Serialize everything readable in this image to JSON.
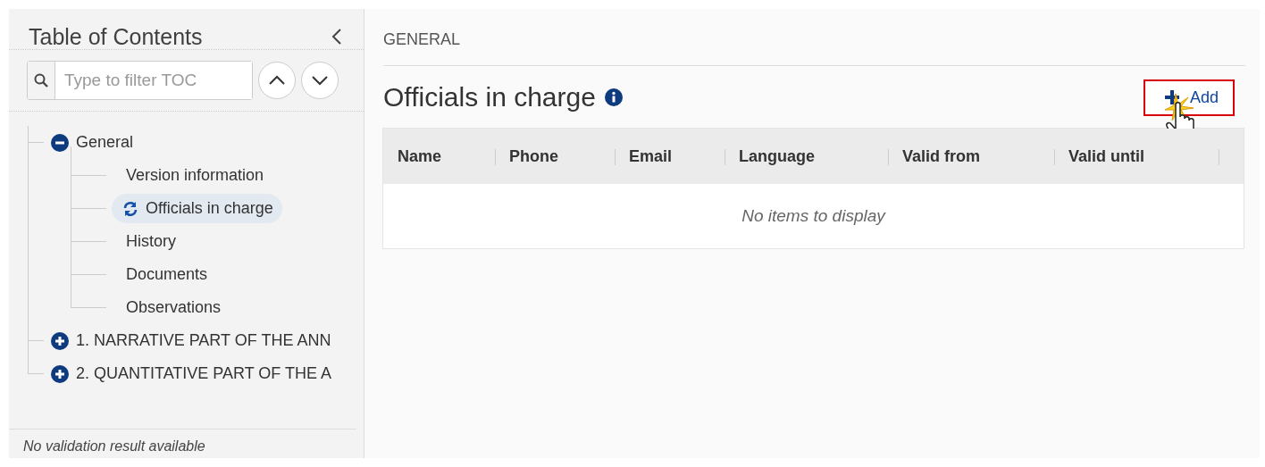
{
  "sidebar": {
    "title": "Table of Contents",
    "filter": {
      "placeholder": "Type to filter TOC"
    },
    "items": [
      {
        "label": "General",
        "expanded": true,
        "children": [
          {
            "label": "Version information",
            "selected": false,
            "kind": "plain"
          },
          {
            "label": "Officials in charge",
            "selected": true,
            "kind": "refresh"
          },
          {
            "label": "History",
            "selected": false,
            "kind": "plain"
          },
          {
            "label": "Documents",
            "selected": false,
            "kind": "plain"
          },
          {
            "label": "Observations",
            "selected": false,
            "kind": "plain"
          }
        ]
      },
      {
        "label": "1. NARRATIVE PART OF THE ANN",
        "expanded": false
      },
      {
        "label": "2. QUANTITATIVE PART OF THE A",
        "expanded": false
      }
    ],
    "footer": "No validation result available"
  },
  "main": {
    "breadcrumb": "GENERAL",
    "heading": "Officials in charge",
    "add_button": {
      "label": "Add",
      "highlighted": true
    },
    "table": {
      "columns": [
        "Name",
        "Phone",
        "Email",
        "Language",
        "Valid from",
        "Valid until"
      ],
      "empty_text": "No items to display"
    }
  }
}
